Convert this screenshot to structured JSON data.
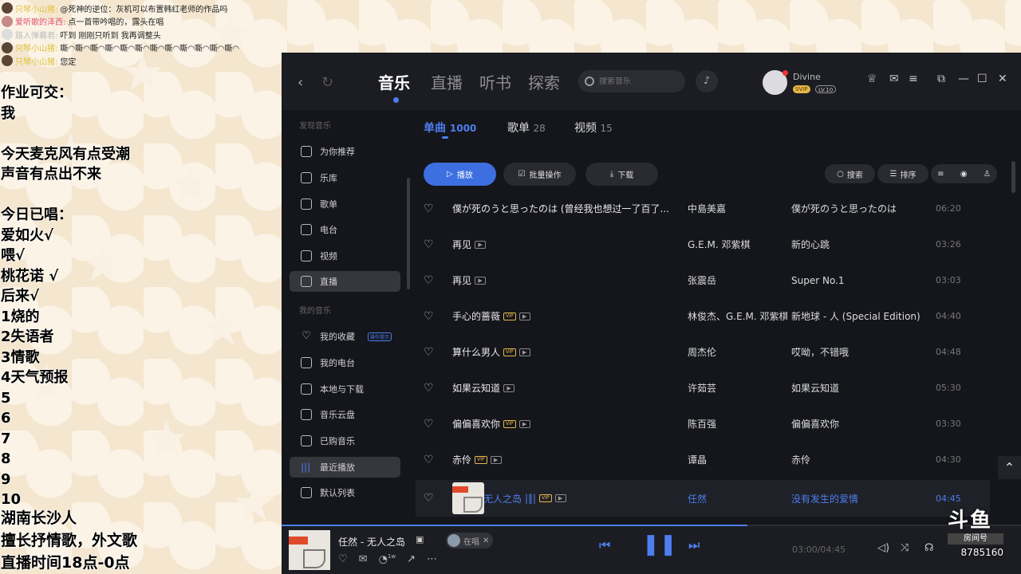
{
  "chat": [
    {
      "name": "只琴小山猪:",
      "name_color": "yellow",
      "text": "@死神的逆位：灰机可以布置韩红老师的作品吗"
    },
    {
      "name": "爱听歌的泽西:",
      "name_color": "pink",
      "text": "点一首带吟唱的，露头在唱"
    },
    {
      "name": "路人弹幕君:",
      "name_color": "grey",
      "text": "吓到 刚刚只听到 我再调整头"
    },
    {
      "name": "只琴小山猪:",
      "name_color": "yellow",
      "text": "嘶◠嘶◠嘶◠嘶◠嘶◠嘶◠嘶◠嘶◠嘶◠嘶◠嘶◠嘶◠"
    },
    {
      "name": "只琴小山猪:",
      "name_color": "yellow",
      "text": "您定"
    }
  ],
  "notes": [
    "作业可交：",
    "我",
    "",
    "今天麦克风有点受潮",
    "声音有点出不来",
    "",
    "今日已唱：",
    "爱如火√",
    "喂√",
    "桃花诺 √",
    "后来√",
    "1烧的",
    "2失语者",
    "3情歌",
    "4天气预报",
    "5",
    "6",
    "7",
    "8",
    "9",
    "10"
  ],
  "notes_bottom": [
    "湖南长沙人",
    "擅长抒情歌，外文歌",
    "直播时间18点-0点"
  ],
  "app": {
    "main_tabs": [
      "音乐",
      "直播",
      "听书",
      "探索"
    ],
    "search_placeholder": "搜索音乐",
    "user": {
      "name": "Divine",
      "svip": "SVIP",
      "level": "LV.10"
    },
    "sidebar": {
      "section_discover": "发现音乐",
      "section_mine": "我的音乐",
      "discover_items": [
        "为你推荐",
        "乐库",
        "歌单",
        "电台",
        "视频",
        "直播"
      ],
      "mine_items": [
        "我的收藏",
        "我的电台",
        "本地与下载",
        "音乐云盘",
        "已购音乐",
        "最近播放",
        "默认列表"
      ],
      "collect_tag": "操作提示"
    },
    "sub_tabs": [
      {
        "label": "单曲",
        "count": "1000"
      },
      {
        "label": "歌单",
        "count": "28"
      },
      {
        "label": "视频",
        "count": "15"
      }
    ],
    "buttons": {
      "play": "播放",
      "batch": "批量操作",
      "download": "下载",
      "search": "搜索",
      "sort": "排序"
    },
    "songs": [
      {
        "title": "僕が死のうと思ったのは (曾经我也想过一了百了...",
        "vip": false,
        "mv": false,
        "artist": "中島美嘉",
        "album": "僕が死のうと思ったのは",
        "duration": "06:20"
      },
      {
        "title": "再见",
        "vip": false,
        "mv": true,
        "artist": "G.E.M. 邓紫棋",
        "album": "新的心跳",
        "duration": "03:26"
      },
      {
        "title": "再见",
        "vip": false,
        "mv": true,
        "artist": "张震岳",
        "album": "Super No.1",
        "duration": "03:03"
      },
      {
        "title": "手心的蔷薇",
        "vip": true,
        "mv": true,
        "artist": "林俊杰、G.E.M. 邓紫棋",
        "album": "新地球 - 人 (Special Edition)",
        "duration": "04:40"
      },
      {
        "title": "算什么男人",
        "vip": true,
        "mv": true,
        "artist": "周杰伦",
        "album": "哎呦，不错哦",
        "duration": "04:48"
      },
      {
        "title": "如果云知道",
        "vip": false,
        "mv": true,
        "artist": "许茹芸",
        "album": "如果云知道",
        "duration": "05:30"
      },
      {
        "title": "偏偏喜欢你",
        "vip": true,
        "mv": true,
        "artist": "陈百强",
        "album": "偏偏喜欢你",
        "duration": "03:30"
      },
      {
        "title": "赤伶",
        "vip": true,
        "mv": true,
        "artist": "谭晶",
        "album": "赤伶",
        "duration": "04:30"
      },
      {
        "title": "无人之岛",
        "vip": true,
        "mv": true,
        "artist": "任然",
        "album": "没有发生的爱情",
        "duration": "04:45",
        "playing": true
      }
    ],
    "player": {
      "now_playing": "任然 - 无人之岛",
      "singing_label": "在唱",
      "time": "03:00/04:45",
      "progress": 0.63,
      "comment_count": "1w"
    }
  },
  "watermark": {
    "logo": "斗鱼",
    "room_label": "房间号",
    "room_number": "8785160"
  }
}
